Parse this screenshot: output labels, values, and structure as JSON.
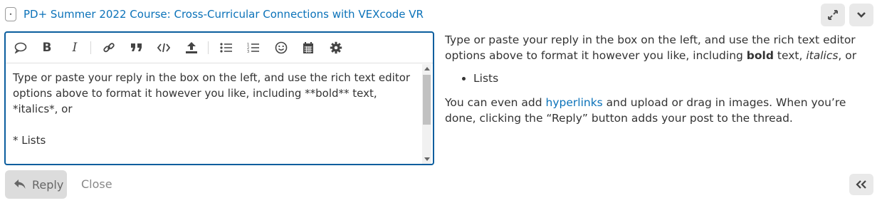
{
  "header": {
    "topic_icon": "topic-icon",
    "title": "PD+ Summer 2022 Course: Cross-Curricular Connections with VEXcode VR",
    "expand_icon": "expand-arrows-icon",
    "collapse_icon": "chevron-down-icon"
  },
  "toolbar": {
    "items": [
      "speech-bubble-icon",
      "bold-icon",
      "italic-icon",
      "link-icon",
      "quote-icon",
      "code-icon",
      "upload-icon",
      "bullet-list-icon",
      "numbered-list-icon",
      "emoji-icon",
      "calendar-icon",
      "gear-icon"
    ]
  },
  "editor": {
    "lines": [
      "Type or paste your reply in the box on the left, and use the rich text editor",
      "options above to format it however you like, including **bold** text,",
      "*italics*, or",
      "",
      "* Lists"
    ]
  },
  "preview": {
    "p1_a": "Type or paste your reply in the box on the left, and use the rich text editor options above to format it however you like, including ",
    "p1_bold": "bold",
    "p1_b": " text, ",
    "p1_italic": "italics",
    "p1_c": ", or",
    "list_item": "Lists",
    "p2_a": "You can even add ",
    "p2_link": "hyperlinks",
    "p2_b": " and upload or drag in images. When you’re done, clicking the “Reply” button adds your post to the thread."
  },
  "footer": {
    "reply_label": "Reply",
    "close_label": "Close",
    "hide_icon": "double-chevron-left-icon"
  }
}
